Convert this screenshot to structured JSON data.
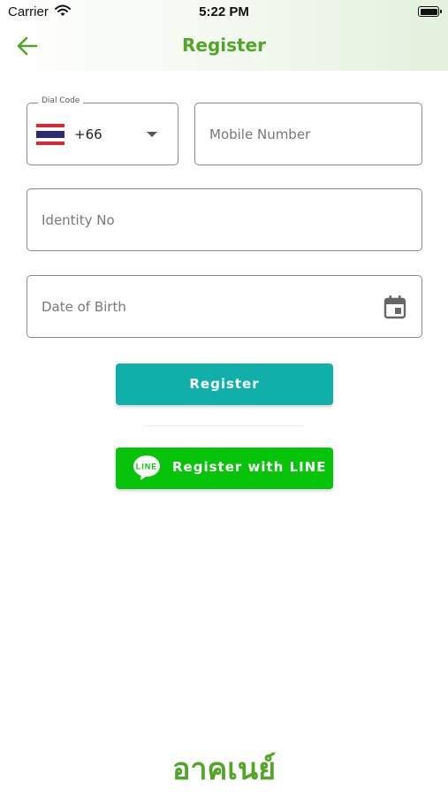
{
  "status_bar": {
    "carrier": "Carrier",
    "time": "5:22 PM"
  },
  "header": {
    "title": "Register",
    "back_icon": "arrow-left-icon"
  },
  "form": {
    "dial_code": {
      "legend": "Dial Code",
      "value": "+66",
      "flag": "thailand-flag"
    },
    "mobile_number": {
      "placeholder": "Mobile Number"
    },
    "identity_no": {
      "placeholder": "Identity No"
    },
    "date_of_birth": {
      "placeholder": "Date of Birth",
      "icon": "calendar-icon"
    }
  },
  "actions": {
    "register_label": "Register",
    "register_with_line_label": "Register with LINE",
    "line_logo_text": "LINE"
  },
  "brand": {
    "name": "อาคเนย์"
  },
  "colors": {
    "brand_green": "#52a526",
    "register_teal": "#11afa9",
    "line_green": "#07c30a"
  }
}
